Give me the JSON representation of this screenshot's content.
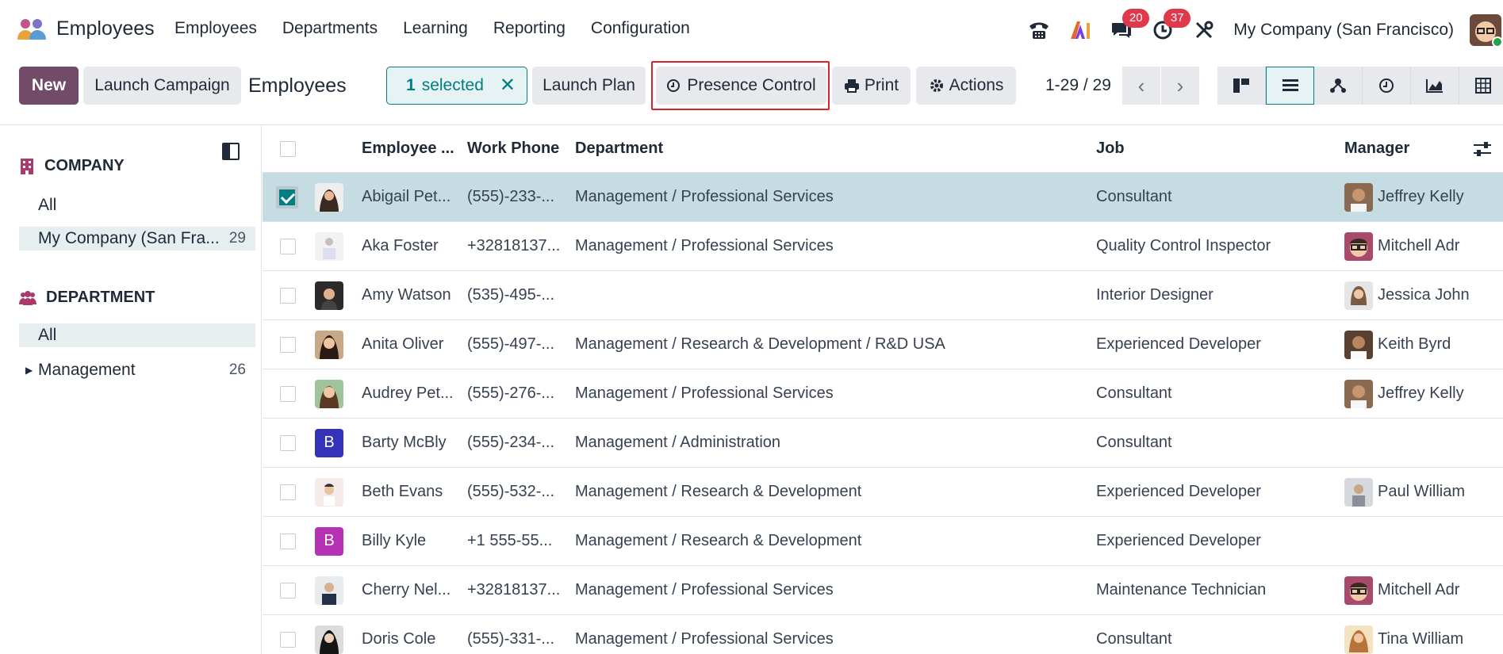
{
  "app": {
    "name": "Employees"
  },
  "menu": [
    "Employees",
    "Departments",
    "Learning",
    "Reporting",
    "Configuration"
  ],
  "systray": {
    "messages_count": "20",
    "activities_count": "37",
    "company": "My Company (San Francisco)"
  },
  "control": {
    "new_label": "New",
    "launch_campaign_label": "Launch Campaign",
    "breadcrumb": "Employees",
    "selected_count": "1",
    "selected_label": "selected",
    "launch_plan_label": "Launch Plan",
    "presence_control_label": "Presence Control",
    "print_label": "Print",
    "actions_label": "Actions",
    "pager": "1-29 / 29"
  },
  "sidebar": {
    "company_heading": "COMPANY",
    "company_items": [
      {
        "label": "All",
        "count": ""
      },
      {
        "label": "My Company (San Fra...",
        "count": "29"
      }
    ],
    "department_heading": "DEPARTMENT",
    "department_items": [
      {
        "label": "All",
        "count": ""
      },
      {
        "label": "Management",
        "count": "26"
      }
    ]
  },
  "colors": {
    "brand": "#714b67",
    "accent": "#017e84",
    "badge": "#e0394b",
    "highlight": "#e0202b"
  },
  "table": {
    "columns": [
      "Employee ...",
      "Work Phone",
      "Department",
      "Job",
      "Manager"
    ],
    "rows": [
      {
        "name": "Abigail Pet...",
        "phone": "(555)-233-...",
        "dept": "Management / Professional Services",
        "job": "Consultant",
        "manager": "Jeffrey Kelly"
      },
      {
        "name": "Aka Foster",
        "phone": "+32818137...",
        "dept": "Management / Professional Services",
        "job": "Quality Control Inspector",
        "manager": "Mitchell Adr"
      },
      {
        "name": "Amy Watson",
        "phone": "(535)-495-...",
        "dept": "",
        "job": "Interior Designer",
        "manager": "Jessica John"
      },
      {
        "name": "Anita Oliver",
        "phone": "(555)-497-...",
        "dept": "Management / Research & Development / R&D USA",
        "job": "Experienced Developer",
        "manager": "Keith Byrd"
      },
      {
        "name": "Audrey Pet...",
        "phone": "(555)-276-...",
        "dept": "Management / Professional Services",
        "job": "Consultant",
        "manager": "Jeffrey Kelly"
      },
      {
        "name": "Barty McBly",
        "phone": "(555)-234-...",
        "dept": "Management / Administration",
        "job": "Consultant",
        "manager": "",
        "initial": "B"
      },
      {
        "name": "Beth Evans",
        "phone": "(555)-532-...",
        "dept": "Management / Research & Development",
        "job": "Experienced Developer",
        "manager": "Paul William"
      },
      {
        "name": "Billy Kyle",
        "phone": "+1 555-55...",
        "dept": "Management / Research & Development",
        "job": "Experienced Developer",
        "manager": "",
        "initial": "B"
      },
      {
        "name": "Cherry Nel...",
        "phone": "+32818137...",
        "dept": "Management / Professional Services",
        "job": "Maintenance Technician",
        "manager": "Mitchell Adr"
      },
      {
        "name": "Doris Cole",
        "phone": "(555)-331-...",
        "dept": "Management / Professional Services",
        "job": "Consultant",
        "manager": "Tina William"
      }
    ]
  }
}
